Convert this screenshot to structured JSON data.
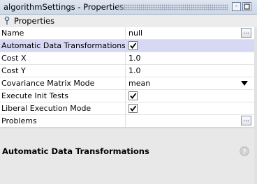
{
  "window": {
    "title": "algorithmSettings - Properties",
    "buttons": {
      "minimize": "-",
      "maximize": "□"
    }
  },
  "toolbar": {
    "label": "Properties",
    "pin_icon": "pin-icon"
  },
  "properties": [
    {
      "name": "Name",
      "value": "null",
      "type": "text",
      "ellipsis": "..."
    },
    {
      "name": "Automatic Data Transformations",
      "type": "checkbox",
      "checked": true,
      "selected": true
    },
    {
      "name": "Cost X",
      "value": "1.0",
      "type": "text"
    },
    {
      "name": "Cost Y",
      "value": "1.0",
      "type": "text"
    },
    {
      "name": "Covariance Matrix Mode",
      "value": "mean",
      "type": "select"
    },
    {
      "name": "Execute Init Tests",
      "type": "checkbox",
      "checked": true
    },
    {
      "name": "Liberal Execution Mode",
      "type": "checkbox",
      "checked": true
    },
    {
      "name": "Problems",
      "value": "",
      "type": "text",
      "ellipsis": "..."
    }
  ],
  "description": {
    "title": "Automatic Data Transformations",
    "help_icon": "help-icon"
  },
  "colors": {
    "selected_row": "#d6d8f4",
    "titlebar": "#cdd7e6",
    "accent": "#6e7f99"
  }
}
